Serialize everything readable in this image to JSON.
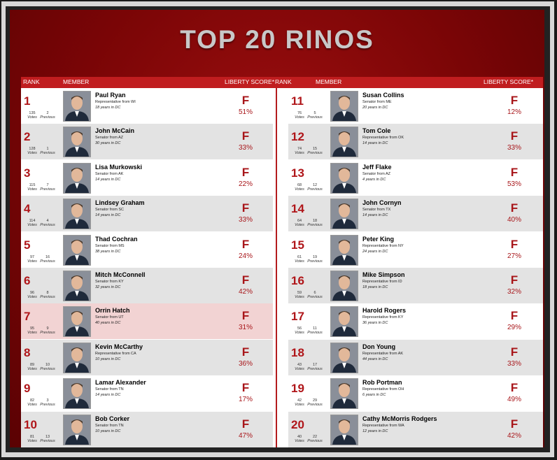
{
  "title": "TOP 20 RINOS",
  "headers": {
    "rank": "RANK",
    "member": "MEMBER",
    "score": "LIBERTY SCORE*"
  },
  "labels": {
    "votes": "Votes",
    "previous": "Previous"
  },
  "colors": {
    "accent": "#b0161a",
    "header_bar": "#c01d1f",
    "background": "#7a0506"
  },
  "members": [
    {
      "rank": "1",
      "name": "Paul Ryan",
      "role": "Representative from WI",
      "years": "18 years in DC",
      "votes": "135",
      "previous": "2",
      "grade": "F",
      "score": "51%"
    },
    {
      "rank": "2",
      "name": "John McCain",
      "role": "Senator from AZ",
      "years": "30 years in DC",
      "votes": "128",
      "previous": "1",
      "grade": "F",
      "score": "33%"
    },
    {
      "rank": "3",
      "name": "Lisa Murkowski",
      "role": "Senator from AK",
      "years": "14 years in DC",
      "votes": "115",
      "previous": "7",
      "grade": "F",
      "score": "22%"
    },
    {
      "rank": "4",
      "name": "Lindsey Graham",
      "role": "Senator from SC",
      "years": "14 years in DC",
      "votes": "114",
      "previous": "4",
      "grade": "F",
      "score": "33%"
    },
    {
      "rank": "5",
      "name": "Thad Cochran",
      "role": "Senator from MS",
      "years": "38 years in DC",
      "votes": "97",
      "previous": "16",
      "grade": "F",
      "score": "24%"
    },
    {
      "rank": "6",
      "name": "Mitch McConnell",
      "role": "Senator from KY",
      "years": "32 years in DC",
      "votes": "96",
      "previous": "8",
      "grade": "F",
      "score": "42%"
    },
    {
      "rank": "7",
      "name": "Orrin Hatch",
      "role": "Senator from UT",
      "years": "40 years in DC",
      "votes": "95",
      "previous": "9",
      "grade": "F",
      "score": "31%"
    },
    {
      "rank": "8",
      "name": "Kevin McCarthy",
      "role": "Representative from CA",
      "years": "10 years in DC",
      "votes": "89",
      "previous": "10",
      "grade": "F",
      "score": "36%"
    },
    {
      "rank": "9",
      "name": "Lamar Alexander",
      "role": "Senator from TN",
      "years": "14 years in DC",
      "votes": "82",
      "previous": "3",
      "grade": "F",
      "score": "17%"
    },
    {
      "rank": "10",
      "name": "Bob Corker",
      "role": "Senator from TN",
      "years": "10 years in DC",
      "votes": "81",
      "previous": "13",
      "grade": "F",
      "score": "47%"
    },
    {
      "rank": "11",
      "name": "Susan Collins",
      "role": "Senator from ME",
      "years": "20 years in DC",
      "votes": "76",
      "previous": "5",
      "grade": "F",
      "score": "12%"
    },
    {
      "rank": "12",
      "name": "Tom Cole",
      "role": "Representative from OK",
      "years": "14 years in DC",
      "votes": "74",
      "previous": "15",
      "grade": "F",
      "score": "33%"
    },
    {
      "rank": "13",
      "name": "Jeff Flake",
      "role": "Senator from AZ",
      "years": "4 years in DC",
      "votes": "68",
      "previous": "12",
      "grade": "F",
      "score": "53%"
    },
    {
      "rank": "14",
      "name": "John Cornyn",
      "role": "Senator from TX",
      "years": "14 years in DC",
      "votes": "64",
      "previous": "18",
      "grade": "F",
      "score": "40%"
    },
    {
      "rank": "15",
      "name": "Peter King",
      "role": "Representative from NY",
      "years": "24 years in DC",
      "votes": "61",
      "previous": "19",
      "grade": "F",
      "score": "27%"
    },
    {
      "rank": "16",
      "name": "Mike Simpson",
      "role": "Representative from ID",
      "years": "18 years in DC",
      "votes": "59",
      "previous": "6",
      "grade": "F",
      "score": "32%"
    },
    {
      "rank": "17",
      "name": "Harold Rogers",
      "role": "Representative from KY",
      "years": "36 years in DC",
      "votes": "56",
      "previous": "11",
      "grade": "F",
      "score": "29%"
    },
    {
      "rank": "18",
      "name": "Don Young",
      "role": "Representative from AK",
      "years": "44 years in DC",
      "votes": "43",
      "previous": "17",
      "grade": "F",
      "score": "33%"
    },
    {
      "rank": "19",
      "name": "Rob Portman",
      "role": "Representative from OH",
      "years": "6 years in DC",
      "votes": "42",
      "previous": "29",
      "grade": "F",
      "score": "49%"
    },
    {
      "rank": "20",
      "name": "Cathy McMorris Rodgers",
      "role": "Representative from WA",
      "years": "12 years in DC",
      "votes": "40",
      "previous": "22",
      "grade": "F",
      "score": "42%"
    }
  ]
}
